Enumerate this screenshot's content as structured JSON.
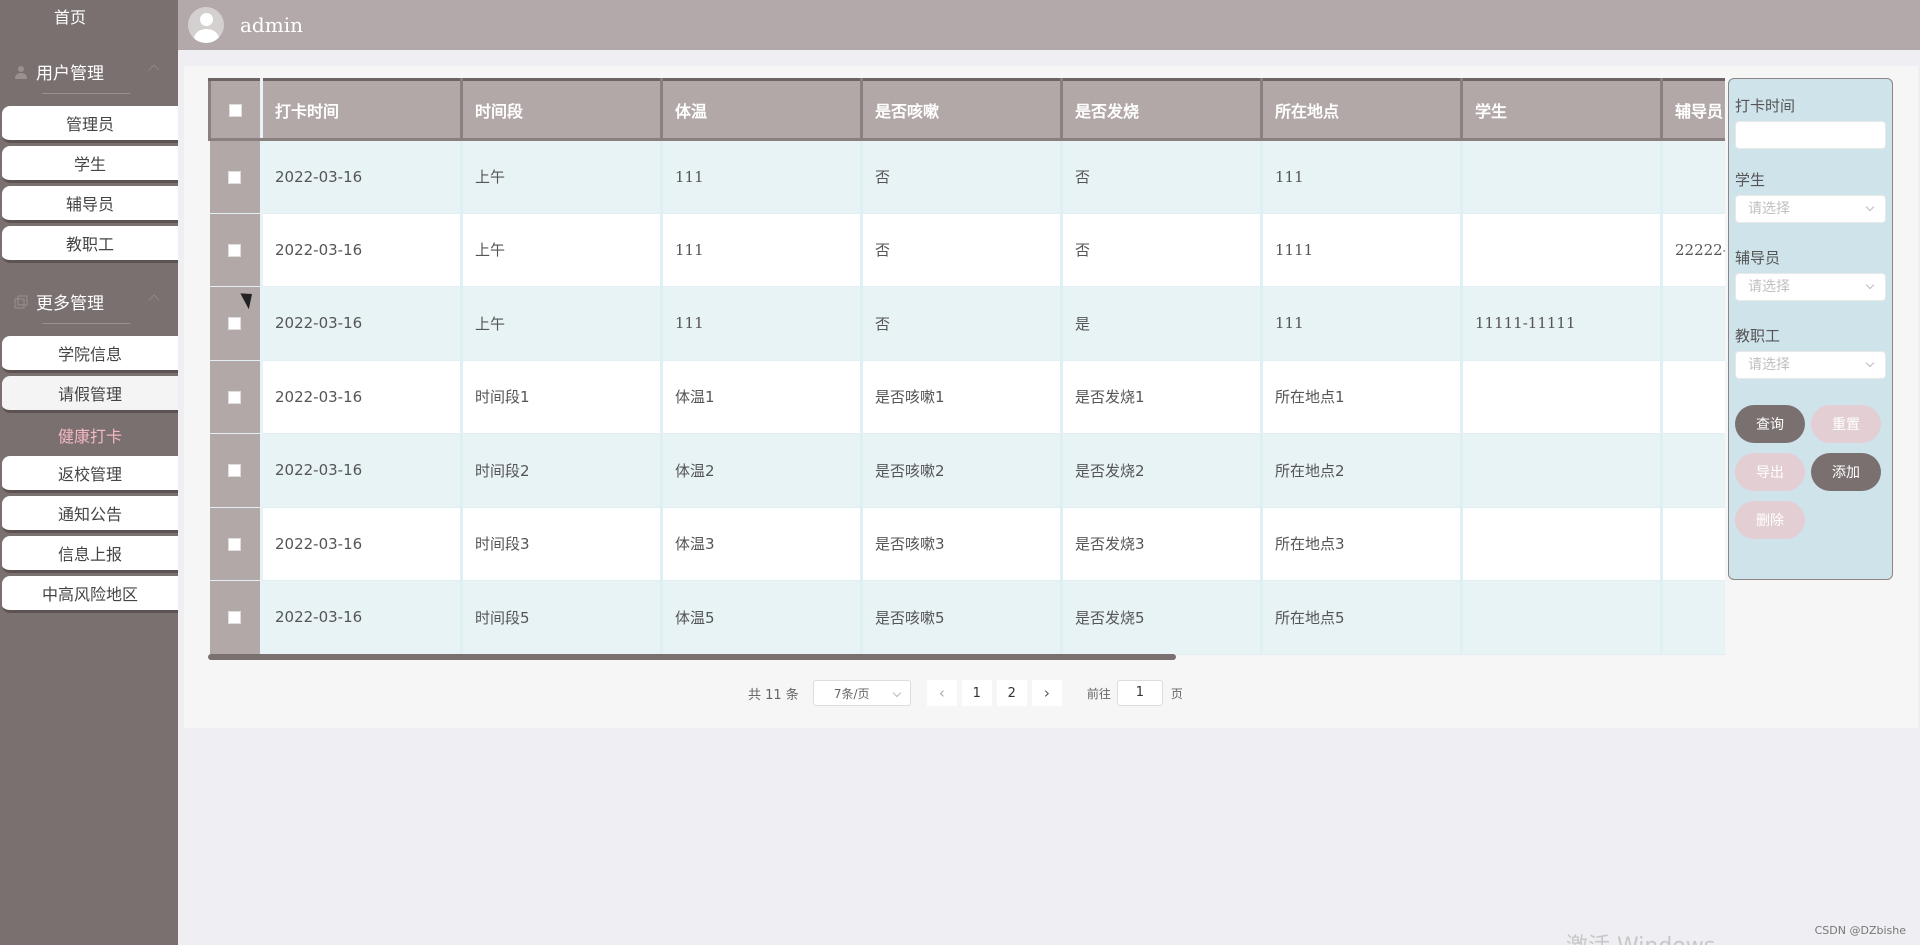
{
  "sidebar": {
    "home": "首页",
    "groups": [
      {
        "label": "用户管理",
        "items": [
          "管理员",
          "学生",
          "辅导员",
          "教职工"
        ]
      },
      {
        "label": "更多管理",
        "items": [
          "学院信息",
          "请假管理",
          "健康打卡",
          "返校管理",
          "通知公告",
          "信息上报",
          "中高风险地区"
        ]
      }
    ],
    "active_item": "健康打卡"
  },
  "header": {
    "username": "admin"
  },
  "table": {
    "columns": [
      "打卡时间",
      "时间段",
      "体温",
      "是否咳嗽",
      "是否发烧",
      "所在地点",
      "学生",
      "辅导员"
    ],
    "rows": [
      [
        "2022-03-16",
        "上午",
        "111",
        "否",
        "否",
        "111",
        "",
        ""
      ],
      [
        "2022-03-16",
        "上午",
        "111",
        "否",
        "否",
        "1111",
        "",
        "22222-"
      ],
      [
        "2022-03-16",
        "上午",
        "111",
        "否",
        "是",
        "111",
        "11111-11111",
        ""
      ],
      [
        "2022-03-16",
        "时间段1",
        "体温1",
        "是否咳嗽1",
        "是否发烧1",
        "所在地点1",
        "",
        ""
      ],
      [
        "2022-03-16",
        "时间段2",
        "体温2",
        "是否咳嗽2",
        "是否发烧2",
        "所在地点2",
        "",
        ""
      ],
      [
        "2022-03-16",
        "时间段3",
        "体温3",
        "是否咳嗽3",
        "是否发烧3",
        "所在地点3",
        "",
        ""
      ],
      [
        "2022-03-16",
        "时间段5",
        "体温5",
        "是否咳嗽5",
        "是否发烧5",
        "所在地点5",
        "",
        ""
      ]
    ]
  },
  "pagination": {
    "total": "共 11 条",
    "page_size": "7条/页",
    "pages": [
      "1",
      "2"
    ],
    "goto_label": "前往",
    "goto_value": "1",
    "page_suffix": "页"
  },
  "search": {
    "fields": [
      {
        "label": "打卡时间",
        "type": "input",
        "value": ""
      },
      {
        "label": "学生",
        "type": "select",
        "placeholder": "请选择"
      },
      {
        "label": "辅导员",
        "type": "select",
        "placeholder": "请选择"
      },
      {
        "label": "教职工",
        "type": "select",
        "placeholder": "请选择"
      }
    ],
    "buttons": {
      "query": "查询",
      "reset": "重置",
      "export": "导出",
      "add": "添加",
      "delete": "删除"
    }
  },
  "footer": {
    "credit": "CSDN @DZbishe",
    "watermark": "激活 Windows"
  },
  "colors": {
    "sidebar": "#7b7070",
    "header": "#b3a9aa",
    "accent_active": "#f2b8c1",
    "row_alt": "#e8f3f6",
    "search_panel": "#cfe3ea"
  }
}
